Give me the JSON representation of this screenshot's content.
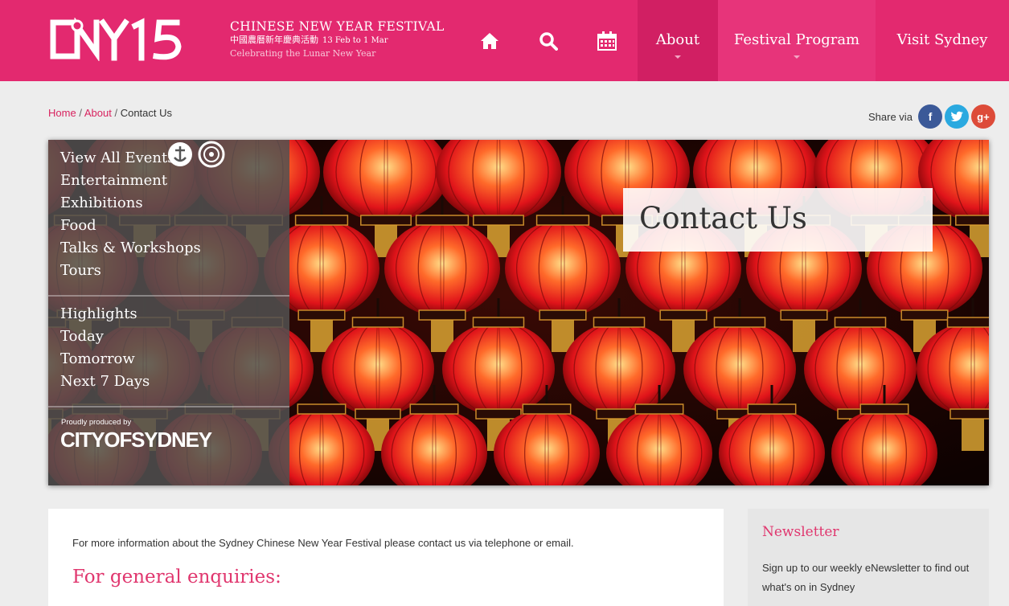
{
  "header": {
    "logo_text": "CNY15",
    "title": "CHINESE NEW YEAR FESTIVAL",
    "chinese": "中國農曆新年慶典活動",
    "dates": "13 Feb to 1 Mar",
    "tagline": "Celebrating the Lunar New Year",
    "nav": {
      "home_icon": "home-icon",
      "search_icon": "search-icon",
      "calendar_icon": "calendar-icon",
      "about": "About",
      "program": "Festival Program",
      "visit": "Visit Sydney"
    }
  },
  "breadcrumb": {
    "home": "Home",
    "sep": "/",
    "about": "About",
    "current": "Contact Us"
  },
  "share": {
    "label": "Share via",
    "facebook": "f",
    "twitter_icon": "twitter-icon",
    "google": "g+",
    "colors": {
      "facebook": "#3b5998",
      "twitter": "#2aa9e0",
      "google": "#dd4b39"
    }
  },
  "sidebar": {
    "group1": [
      "View All Events",
      "Entertainment",
      "Exhibitions",
      "Food",
      "Talks & Workshops",
      "Tours"
    ],
    "group2": [
      "Highlights",
      "Today",
      "Tomorrow",
      "Next 7 Days"
    ],
    "produced_by": "Proudly produced by",
    "city_logo": "CITYOFSYDNEY"
  },
  "banner": {
    "title": "Contact Us"
  },
  "content": {
    "intro": "For more information about the Sydney Chinese New Year Festival please contact us via telephone or email.",
    "heading": "For general enquiries:"
  },
  "newsletter": {
    "title": "Newsletter",
    "body": "Sign up to our weekly eNewsletter to find out what's on in Sydney"
  },
  "colors": {
    "brand": "#e3296f",
    "accent": "#e0366e",
    "link": "#d8235f"
  }
}
